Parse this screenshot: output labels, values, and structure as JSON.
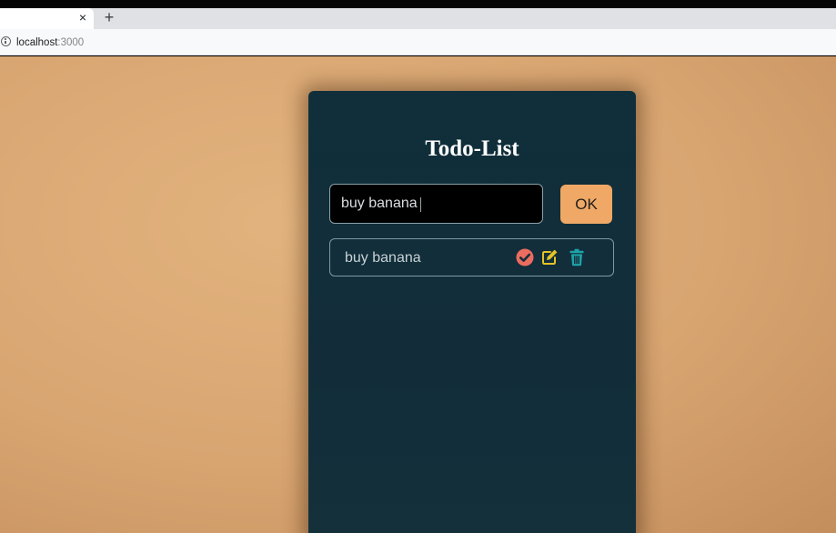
{
  "browser": {
    "close_tab_glyph": "×",
    "new_tab_glyph": "+",
    "url_host": "localhost",
    "url_port": ":3000"
  },
  "app": {
    "title": "Todo-List",
    "input_value": "buy banana",
    "ok_label": "OK",
    "todos": [
      {
        "text": "buy banana"
      }
    ]
  },
  "colors": {
    "page_background": "#d8a571",
    "card_background": "#102f3b",
    "ok_button": "#efa865",
    "check_icon": "#ec6c5f",
    "edit_icon": "#e4c326",
    "trash_icon": "#1fa2a8"
  },
  "icons": {
    "tab_close": "close-icon",
    "new_tab": "plus-icon",
    "site_info": "info-icon",
    "complete": "check-circle-icon",
    "edit": "edit-icon",
    "delete": "trash-icon"
  }
}
